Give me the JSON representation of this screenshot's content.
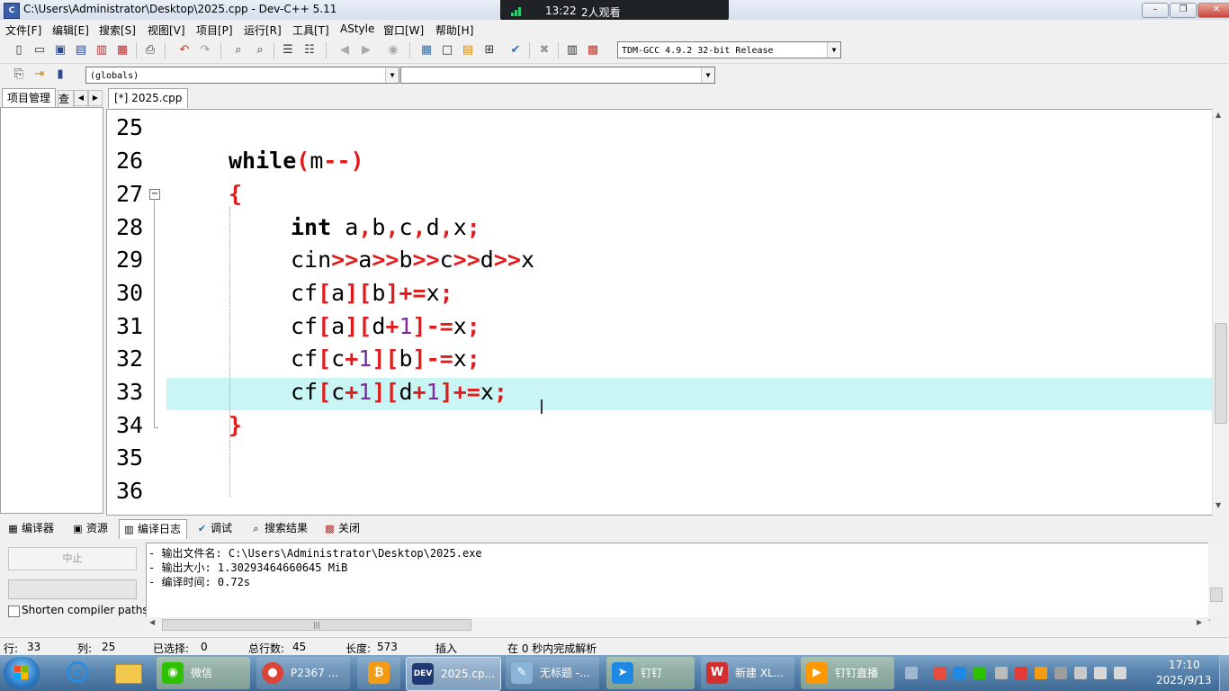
{
  "window": {
    "title": "C:\\Users\\Administrator\\Desktop\\2025.cpp - Dev-C++ 5.11",
    "app_icon_text": "C"
  },
  "meeting": {
    "time": "13:22",
    "viewers": "2人观看"
  },
  "menu": [
    "文件[F]",
    "编辑[E]",
    "搜索[S]",
    "视图[V]",
    "项目[P]",
    "运行[R]",
    "工具[T]",
    "AStyle",
    "窗口[W]",
    "帮助[H]"
  ],
  "toolbar": {
    "compiler": "TDM-GCC 4.9.2 32-bit Release",
    "scope": "(globals)",
    "symbol": ""
  },
  "left_panel": {
    "tab_project": "项目管理",
    "tab_classes": "查"
  },
  "editor": {
    "file_tab": "[*] 2025.cpp",
    "line_numbers": [
      "25",
      "26",
      "27",
      "28",
      "29",
      "30",
      "31",
      "32",
      "33",
      "34",
      "35",
      "36"
    ]
  },
  "bottom_tabs": [
    "编译器",
    "资源",
    "编译日志",
    "调试",
    "搜索结果",
    "关闭"
  ],
  "log": {
    "abort_label": "中止",
    "shorten_label": "Shorten compiler paths",
    "lines": [
      "- 输出文件名: C:\\Users\\Administrator\\Desktop\\2025.exe",
      "- 输出大小: 1.30293464660645 MiB",
      "- 编译时间: 0.72s"
    ]
  },
  "status": {
    "row_label": "行:",
    "row": "33",
    "col_label": "列:",
    "col": "25",
    "sel_label": "已选择:",
    "sel": "0",
    "lines_label": "总行数:",
    "lines": "45",
    "len_label": "长度:",
    "len": "573",
    "mode": "插入",
    "parse": "在 0 秒内完成解析"
  },
  "taskbar": {
    "items": [
      "微信",
      "P2367 ...",
      "",
      "2025.cp...",
      "无标题 -...",
      "钉钉",
      "新建 XL...",
      "钉钉直播"
    ],
    "time": "17:10",
    "date": "2025/9/13"
  },
  "colors": {
    "current_line": "#c9f5f5",
    "symbol": "#e01b1b",
    "number": "#7a2b9e"
  }
}
